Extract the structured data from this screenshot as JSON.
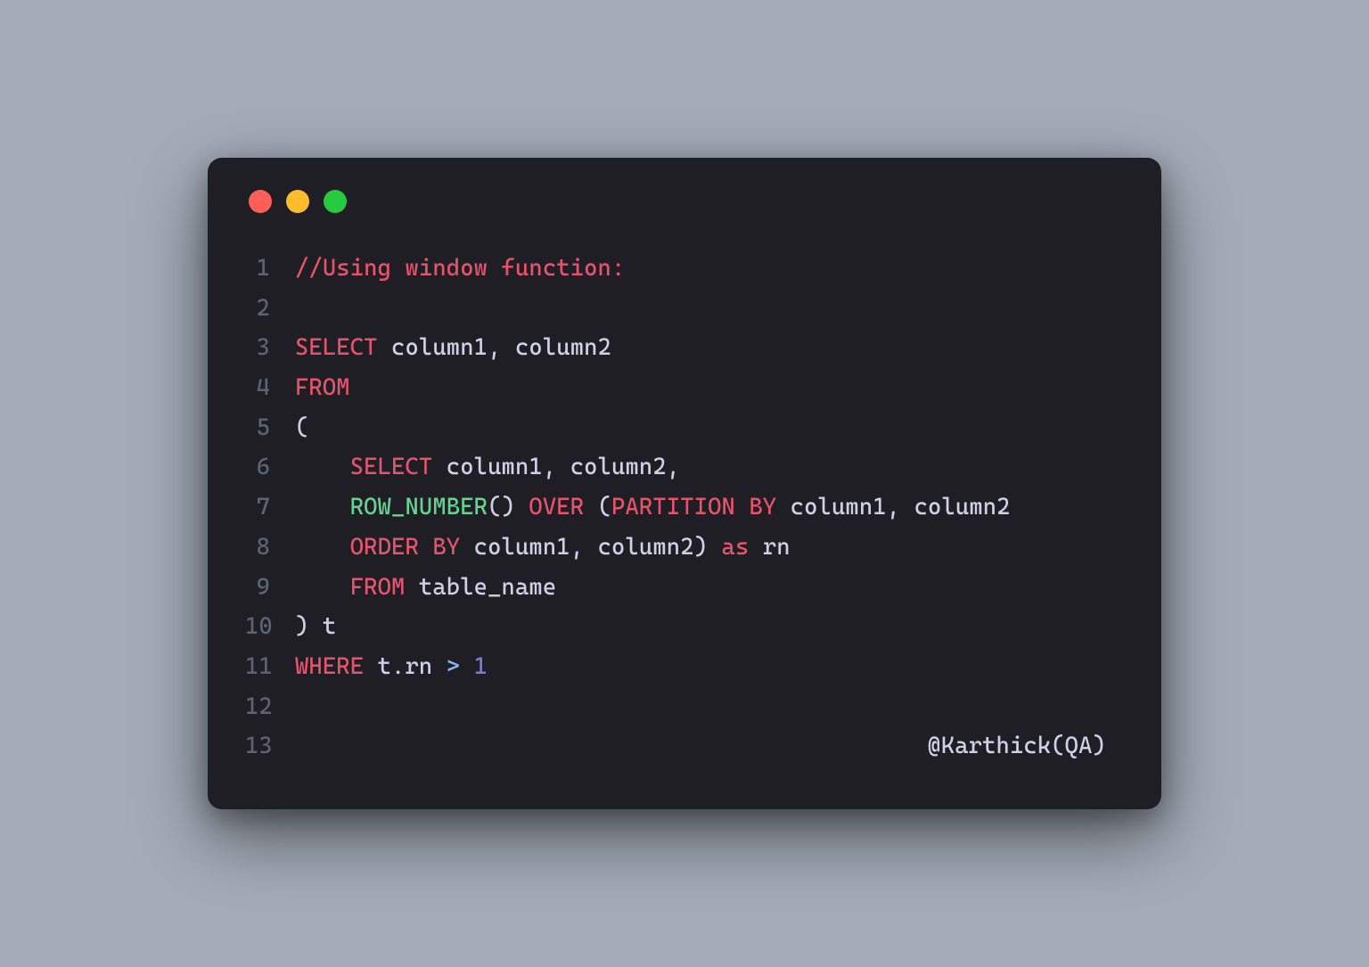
{
  "dots": {
    "red": "#ff5f56",
    "yellow": "#ffbd2e",
    "green": "#27c93f"
  },
  "lines": [
    {
      "n": "1",
      "tokens": [
        {
          "cls": "comment",
          "t": "//Using window function:"
        }
      ]
    },
    {
      "n": "2",
      "tokens": []
    },
    {
      "n": "3",
      "tokens": [
        {
          "cls": "keyword",
          "t": "SELECT"
        },
        {
          "cls": "identifier",
          "t": " column1"
        },
        {
          "cls": "punct",
          "t": ","
        },
        {
          "cls": "identifier",
          "t": " column2"
        }
      ]
    },
    {
      "n": "4",
      "tokens": [
        {
          "cls": "keyword",
          "t": "FROM"
        }
      ]
    },
    {
      "n": "5",
      "tokens": [
        {
          "cls": "punct",
          "t": "("
        }
      ]
    },
    {
      "n": "6",
      "tokens": [
        {
          "cls": "identifier",
          "t": "    "
        },
        {
          "cls": "keyword",
          "t": "SELECT"
        },
        {
          "cls": "identifier",
          "t": " column1"
        },
        {
          "cls": "punct",
          "t": ","
        },
        {
          "cls": "identifier",
          "t": " column2"
        },
        {
          "cls": "punct",
          "t": ","
        }
      ]
    },
    {
      "n": "7",
      "tokens": [
        {
          "cls": "identifier",
          "t": "    "
        },
        {
          "cls": "func",
          "t": "ROW_NUMBER"
        },
        {
          "cls": "punct",
          "t": "()"
        },
        {
          "cls": "identifier",
          "t": " "
        },
        {
          "cls": "keyword",
          "t": "OVER"
        },
        {
          "cls": "identifier",
          "t": " "
        },
        {
          "cls": "punct",
          "t": "("
        },
        {
          "cls": "keyword",
          "t": "PARTITION BY"
        },
        {
          "cls": "identifier",
          "t": " column1"
        },
        {
          "cls": "punct",
          "t": ","
        },
        {
          "cls": "identifier",
          "t": " column2"
        }
      ]
    },
    {
      "n": "8",
      "tokens": [
        {
          "cls": "identifier",
          "t": "    "
        },
        {
          "cls": "keyword",
          "t": "ORDER BY"
        },
        {
          "cls": "identifier",
          "t": " column1"
        },
        {
          "cls": "punct",
          "t": ","
        },
        {
          "cls": "identifier",
          "t": " column2"
        },
        {
          "cls": "punct",
          "t": ")"
        },
        {
          "cls": "identifier",
          "t": " "
        },
        {
          "cls": "keyword",
          "t": "as"
        },
        {
          "cls": "identifier",
          "t": " rn"
        }
      ]
    },
    {
      "n": "9",
      "tokens": [
        {
          "cls": "identifier",
          "t": "    "
        },
        {
          "cls": "keyword",
          "t": "FROM"
        },
        {
          "cls": "identifier",
          "t": " table_name"
        }
      ]
    },
    {
      "n": "10",
      "tokens": [
        {
          "cls": "punct",
          "t": ")"
        },
        {
          "cls": "identifier",
          "t": " t"
        }
      ]
    },
    {
      "n": "11",
      "tokens": [
        {
          "cls": "keyword",
          "t": "WHERE"
        },
        {
          "cls": "identifier",
          "t": " t"
        },
        {
          "cls": "punct",
          "t": "."
        },
        {
          "cls": "identifier",
          "t": "rn "
        },
        {
          "cls": "operator",
          "t": ">"
        },
        {
          "cls": "identifier",
          "t": " "
        },
        {
          "cls": "number",
          "t": "1"
        }
      ]
    },
    {
      "n": "12",
      "tokens": []
    },
    {
      "n": "13",
      "rightalign": true,
      "tokens": [
        {
          "cls": "sig",
          "t": "@Karthick(QA)"
        }
      ]
    }
  ]
}
